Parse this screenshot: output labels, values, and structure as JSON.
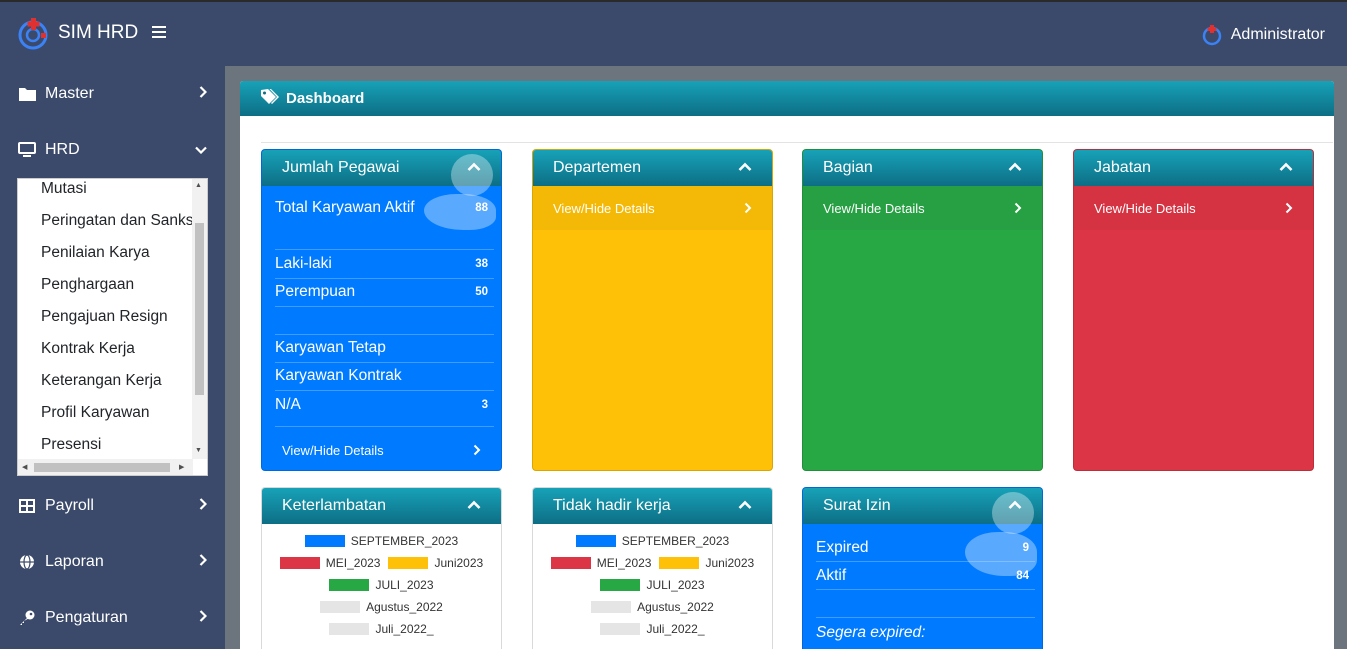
{
  "app": {
    "title": "SIM HRD",
    "user": "Administrator"
  },
  "colors": {
    "topbar": "#3b4a6b",
    "header_teal": "#17a2b8",
    "blue": "#007bff",
    "yellow": "#ffc107",
    "green": "#28a745",
    "red": "#dc3545"
  },
  "sidebar": {
    "items": [
      {
        "label": "Master",
        "icon": "folder-icon"
      },
      {
        "label": "HRD",
        "icon": "monitor-icon"
      },
      {
        "label": "Payroll",
        "icon": "table-icon"
      },
      {
        "label": "Laporan",
        "icon": "globe-icon"
      },
      {
        "label": "Pengaturan",
        "icon": "key-icon"
      }
    ],
    "hrd_submenu": [
      "Mutasi",
      "Peringatan dan Sanksi",
      "Penilaian Karya",
      "Penghargaan",
      "Pengajuan Resign",
      "Kontrak Kerja",
      "Keterangan Kerja",
      "Profil Karyawan",
      "Presensi"
    ]
  },
  "page": {
    "title": "Dashboard"
  },
  "cards": {
    "pegawai": {
      "title": "Jumlah Pegawai",
      "total_label": "Total Karyawan Aktif",
      "total_value": "88",
      "male_label": "Laki-laki",
      "male_value": "38",
      "female_label": "Perempuan",
      "female_value": "50",
      "tetap_label": "Karyawan Tetap",
      "kontrak_label": "Karyawan Kontrak",
      "na_label": "N/A",
      "na_value": "3",
      "details": "View/Hide Details"
    },
    "departemen": {
      "title": "Departemen",
      "details": "View/Hide Details"
    },
    "bagian": {
      "title": "Bagian",
      "details": "View/Hide Details"
    },
    "jabatan": {
      "title": "Jabatan",
      "details": "View/Hide Details"
    },
    "keterlambatan": {
      "title": "Keterlambatan",
      "legend": [
        [
          {
            "label": "SEPTEMBER_2023",
            "color": "#007bff"
          }
        ],
        [
          {
            "label": "MEI_2023",
            "color": "#dc3545"
          },
          {
            "label": "Juni2023",
            "color": "#ffc107"
          }
        ],
        [
          {
            "label": "JULI_2023",
            "color": "#28a745"
          }
        ],
        [
          {
            "label": "Agustus_2022",
            "color": "#e5e5e5"
          }
        ],
        [
          {
            "label": "Juli_2022_",
            "color": "#e5e5e5"
          }
        ]
      ]
    },
    "tidak_hadir": {
      "title": "Tidak hadir kerja",
      "legend": [
        [
          {
            "label": "SEPTEMBER_2023",
            "color": "#007bff"
          }
        ],
        [
          {
            "label": "MEI_2023",
            "color": "#dc3545"
          },
          {
            "label": "Juni2023",
            "color": "#ffc107"
          }
        ],
        [
          {
            "label": "JULI_2023",
            "color": "#28a745"
          }
        ],
        [
          {
            "label": "Agustus_2022",
            "color": "#e5e5e5"
          }
        ],
        [
          {
            "label": "Juli_2022_",
            "color": "#e5e5e5"
          }
        ]
      ]
    },
    "surat_izin": {
      "title": "Surat Izin",
      "expired_label": "Expired",
      "expired_value": "9",
      "aktif_label": "Aktif",
      "aktif_value": "84",
      "segera_label": "Segera expired:"
    }
  }
}
